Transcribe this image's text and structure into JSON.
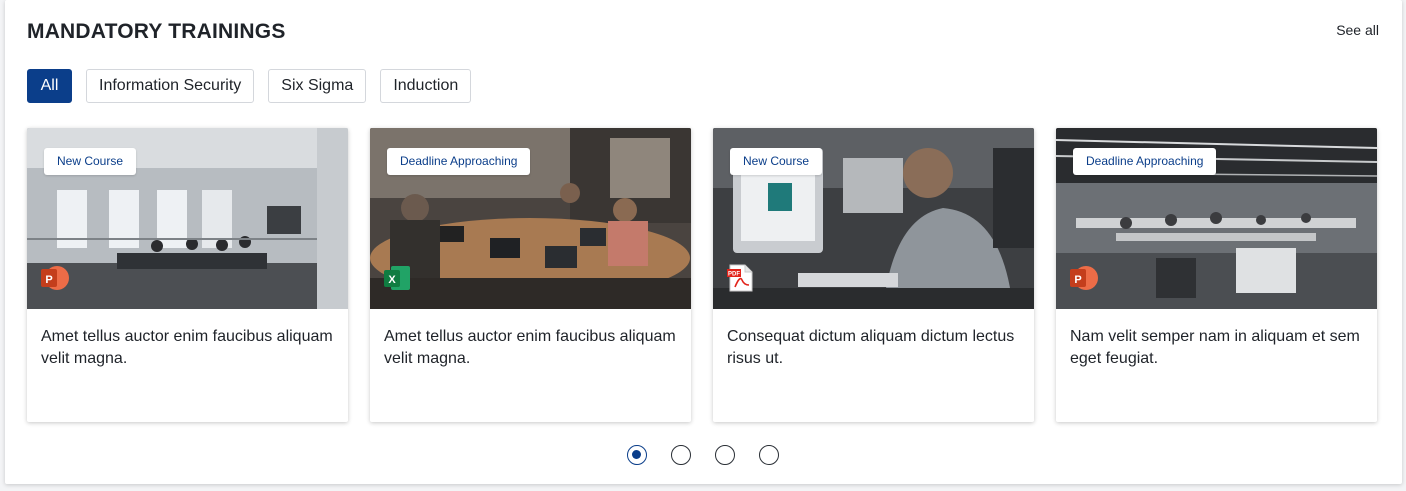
{
  "header": {
    "title": "MANDATORY TRAININGS",
    "see_all": "See all"
  },
  "filters": [
    {
      "label": "All",
      "active": true
    },
    {
      "label": "Information Security",
      "active": false
    },
    {
      "label": "Six Sigma",
      "active": false
    },
    {
      "label": "Induction",
      "active": false
    }
  ],
  "cards": [
    {
      "badge": "New Course",
      "title": "Amet tellus auctor enim faucibus aliquam velit magna.",
      "file_type": "powerpoint-icon",
      "photo": "glass-meeting-room"
    },
    {
      "badge": "Deadline Approaching",
      "title": "Amet tellus auctor enim faucibus aliquam velit magna.",
      "file_type": "excel-icon",
      "photo": "team-table-laptops"
    },
    {
      "badge": "New Course",
      "title": "Consequat dictum aliquam dictum lectus risus ut.",
      "file_type": "pdf-icon",
      "photo": "man-at-monitor"
    },
    {
      "badge": "Deadline Approaching",
      "title": "Nam velit semper nam in aliquam et sem eget feugiat.",
      "file_type": "powerpoint-icon",
      "photo": "open-plan-office"
    }
  ],
  "pagination": {
    "pages": 4,
    "current": 1
  },
  "colors": {
    "accent": "#0b3e8a",
    "powerpoint": "#d24726",
    "excel": "#1d6f42",
    "pdf": "#e2231a"
  }
}
